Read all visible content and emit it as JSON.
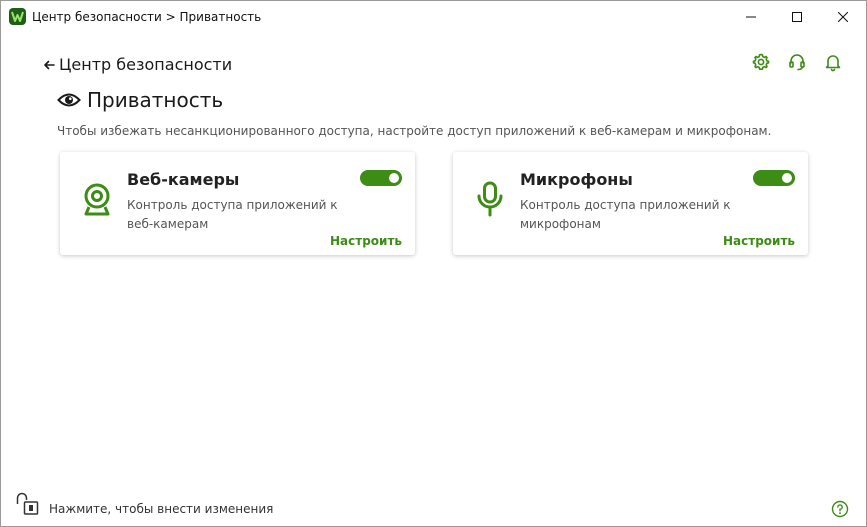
{
  "window": {
    "title": "Центр безопасности > Приватность",
    "icons": [
      "app-logo-icon",
      "minimize-icon",
      "maximize-icon",
      "close-icon"
    ]
  },
  "header": {
    "back_label": "Центр безопасности",
    "icons": [
      "gear-icon",
      "headset-icon",
      "bell-icon"
    ]
  },
  "page": {
    "title": "Приватность",
    "title_icon": "eye-icon",
    "description": "Чтобы избежать несанкционированного доступа, настройте доступ приложений к веб-камерам и микрофонам."
  },
  "cards": [
    {
      "title": "Веб-камеры",
      "description": "Контроль доступа приложений к веб-камерам",
      "link": "Настроить",
      "enabled": true,
      "icon": "webcam-icon"
    },
    {
      "title": "Микрофоны",
      "description": "Контроль доступа приложений к микрофонам",
      "link": "Настроить",
      "enabled": true,
      "icon": "microphone-icon"
    }
  ],
  "footer": {
    "text": "Нажмите, чтобы внести изменения",
    "icons": [
      "lock-icon",
      "help-icon"
    ]
  },
  "colors": {
    "accent": "#3c8c16",
    "logo": "#1f5e16",
    "text": "#222222",
    "muted": "#555555"
  }
}
